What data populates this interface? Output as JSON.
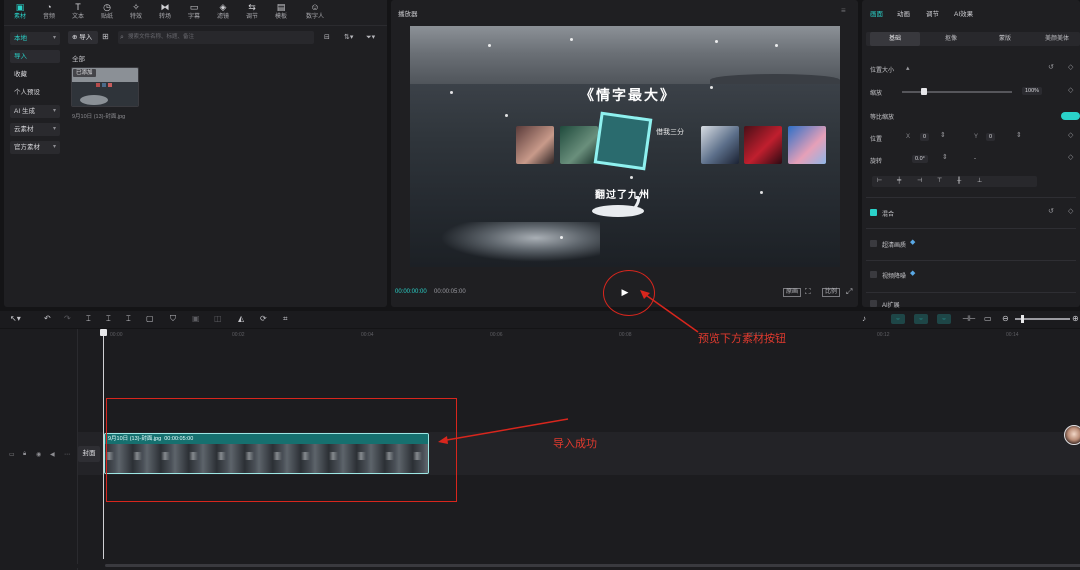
{
  "tool_tabs": [
    {
      "label": "素材",
      "icon": "media-icon"
    },
    {
      "label": "音频",
      "icon": "audio-icon"
    },
    {
      "label": "文本",
      "icon": "text-icon"
    },
    {
      "label": "贴纸",
      "icon": "sticker-icon"
    },
    {
      "label": "特效",
      "icon": "effects-icon"
    },
    {
      "label": "转场",
      "icon": "transition-icon"
    },
    {
      "label": "字幕",
      "icon": "subtitle-icon"
    },
    {
      "label": "滤镜",
      "icon": "filter-icon"
    },
    {
      "label": "调节",
      "icon": "adjust-icon"
    },
    {
      "label": "模板",
      "icon": "template-icon"
    },
    {
      "label": "数字人",
      "icon": "digital-human-icon"
    }
  ],
  "side_nav": [
    {
      "label": "本地"
    },
    {
      "label": "导入"
    },
    {
      "label": "收藏"
    },
    {
      "label": "个人预设"
    },
    {
      "label": "AI 生成"
    },
    {
      "label": "云素材"
    },
    {
      "label": "官方素材"
    }
  ],
  "media": {
    "import_label": "导入",
    "search_placeholder": "搜索文件名称、标题、备注",
    "all_label": "全部",
    "added_badge": "已添加",
    "filename": "9月10日 (13)-封面.jpg"
  },
  "player": {
    "title": "播放器",
    "time_current": "00:00:00:00",
    "time_total": "00:00:05:00",
    "play_symbol": "▶",
    "ctrl_labels": [
      "原画",
      "比例"
    ],
    "video": {
      "title": "《情字最大》",
      "handwrite": "借我三分",
      "subtitle": "翻过了九州"
    }
  },
  "props": {
    "tabs": [
      "画面",
      "动画",
      "调节",
      "AI效果"
    ],
    "subtabs": [
      "基础",
      "抠像",
      "蒙版",
      "美颜美体"
    ],
    "position_size": "位置大小",
    "scale_label": "缩放",
    "scale_value": "100%",
    "uniform_label": "等比缩放",
    "position_label": "位置",
    "pos_x_label": "X",
    "pos_x": "0",
    "pos_y_label": "Y",
    "pos_y": "0",
    "rotate_label": "旋转",
    "rotate_value": "0.0°",
    "rotate_dash": "-",
    "blend_label": "混合",
    "super_res_label": "超清画质",
    "denoise_label": "视频降噪",
    "ai_label": "AI扩展"
  },
  "timeline": {
    "ticks": [
      "00:00",
      "00:02",
      "00:04",
      "00:06",
      "00:08",
      "00:10",
      "00:12",
      "00:14"
    ],
    "cover_label": "封面",
    "clip_name": "9月10日 (13)-封面.jpg",
    "clip_duration": "00:00:05:00"
  },
  "annotations": {
    "play_text": "预览下方素材按钮",
    "import_text": "导入成功"
  },
  "colors": {
    "accent": "#2ad2c9",
    "annotation_red": "#d8261d"
  }
}
